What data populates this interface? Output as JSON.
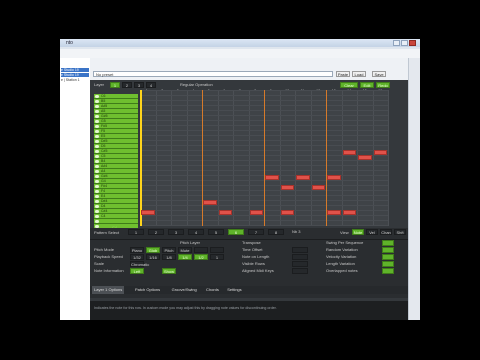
{
  "browser": {
    "window_title": "nto",
    "url_value": "No preset",
    "side_items": [
      "e Studio 19",
      "e Studio 19",
      "e | Station 1"
    ],
    "toolbar": {
      "paste_label": "Paste",
      "load_label": "Load",
      "save_label": "Save"
    }
  },
  "app": {
    "top": {
      "layer_label": "Layer",
      "layer_tabs": [
        "1",
        "2",
        "3",
        "4"
      ],
      "mode_label": "Regular Operation",
      "right_buttons": [
        "Clear",
        "Edit",
        "Redo"
      ]
    },
    "colors": {
      "accent_green": "#5fb32a",
      "note_red": "#e0524a",
      "playhead_yellow": "#ffd41c",
      "beat_orange": "#d67a2a",
      "panel_dark": "#34383c"
    },
    "column_numbers": [
      "1",
      "2",
      "3",
      "4",
      "5",
      "6",
      "7",
      "8",
      "9",
      "10",
      "11",
      "12",
      "13",
      "14",
      "15",
      "16"
    ],
    "piano_keys": [
      "C6",
      "B5",
      "A#5",
      "A5",
      "G#5",
      "G5",
      "F#5",
      "F5",
      "E5",
      "D#5",
      "D5",
      "C#5",
      "C5",
      "B4",
      "A#4",
      "A4",
      "G#4",
      "G4",
      "F#4",
      "F4",
      "E4",
      "D#4",
      "D4",
      "C#4",
      "C4",
      "",
      "",
      ""
    ],
    "keys_footer": "C4",
    "notes": [
      {
        "row": 12,
        "col": 13.0,
        "len": 1.0
      },
      {
        "row": 12,
        "col": 15.0,
        "len": 1.0
      },
      {
        "row": 13,
        "col": 14.0,
        "len": 1.0
      },
      {
        "row": 17,
        "col": 8.0,
        "len": 1.0
      },
      {
        "row": 17,
        "col": 10.0,
        "len": 1.0
      },
      {
        "row": 17,
        "col": 12.0,
        "len": 1.0
      },
      {
        "row": 19,
        "col": 9.0,
        "len": 1.0
      },
      {
        "row": 19,
        "col": 11.0,
        "len": 1.0
      },
      {
        "row": 22,
        "col": 4.0,
        "len": 1.0
      },
      {
        "row": 24,
        "col": 0.0,
        "len": 1.0
      },
      {
        "row": 24,
        "col": 5.0,
        "len": 1.0
      },
      {
        "row": 24,
        "col": 7.0,
        "len": 1.0
      },
      {
        "row": 24,
        "col": 9.0,
        "len": 1.0
      },
      {
        "row": 24,
        "col": 12.0,
        "len": 1.0
      },
      {
        "row": 24,
        "col": 13.0,
        "len": 1.0
      }
    ],
    "pattern": {
      "label": "Pattern Select",
      "steps": [
        "1",
        "2",
        "3",
        "4",
        "5",
        "6",
        "7",
        "8"
      ],
      "active_step": "6",
      "extra_label": "Nb 3",
      "view_label": "View",
      "view_buttons": [
        "Note",
        "Vel",
        "Chan",
        "Shft"
      ]
    },
    "controls": {
      "section_title": "Pitch Layer",
      "rows": [
        {
          "label": "Pitch Mode",
          "values": [
            "Piano",
            "Glob",
            "Pitch Mode",
            "Mute",
            "",
            ""
          ]
        },
        {
          "label": "Playback Speed",
          "values": [
            "1/32",
            "1/16",
            "1/8",
            "1/4",
            "1/2",
            "1"
          ]
        },
        {
          "label": "Scale",
          "values": [
            "Chromatic",
            "",
            "",
            "",
            "",
            ""
          ]
        },
        {
          "label": "Note Information",
          "values": [
            "Left",
            "",
            "Show",
            "",
            "",
            ""
          ]
        }
      ],
      "middle_title": "Transpose",
      "middle_rows": [
        "Time Offset",
        "Note on Length",
        "Visible Rows",
        "Aligned Midi Keys"
      ],
      "right_rows": [
        "Swing Per Sequence",
        "Random Variation",
        "Velocity Variation",
        "Length Variation",
        "Overlapped notes"
      ],
      "right_values": [
        "",
        "",
        "",
        "",
        ""
      ]
    },
    "tabs": [
      "Layer 1 Options",
      "Patch Options",
      "Groove/Swing",
      "Chords",
      "Settings"
    ],
    "info_text": "Indicates the note for this row. In custom mode you may adjust this by dragging note values for discontinuing order."
  }
}
